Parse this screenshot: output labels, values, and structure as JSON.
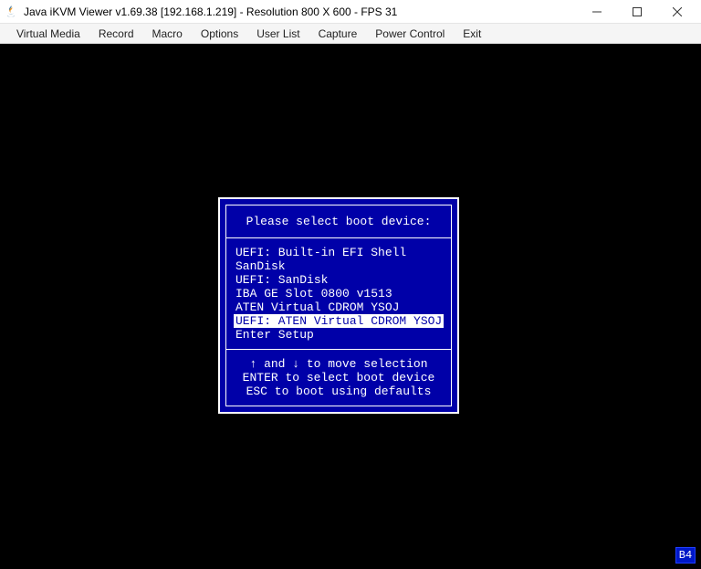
{
  "window": {
    "title": "Java iKVM Viewer v1.69.38 [192.168.1.219]  - Resolution 800 X 600 - FPS 31"
  },
  "menubar": {
    "items": [
      "Virtual Media",
      "Record",
      "Macro",
      "Options",
      "User List",
      "Capture",
      "Power Control",
      "Exit"
    ]
  },
  "bios": {
    "title": "Please select boot device:",
    "devices": [
      {
        "label": "UEFI: Built-in EFI Shell",
        "selected": false
      },
      {
        "label": "SanDisk",
        "selected": false
      },
      {
        "label": "UEFI: SanDisk",
        "selected": false
      },
      {
        "label": "IBA GE Slot 0800 v1513",
        "selected": false
      },
      {
        "label": "ATEN Virtual CDROM YSOJ",
        "selected": false
      },
      {
        "label": "UEFI: ATEN Virtual CDROM YSOJ",
        "selected": true
      },
      {
        "label": "Enter Setup",
        "selected": false
      }
    ],
    "hints": [
      "↑ and ↓ to move selection",
      "ENTER to select boot device",
      "ESC to boot using defaults"
    ]
  },
  "corner_badge": "B4"
}
